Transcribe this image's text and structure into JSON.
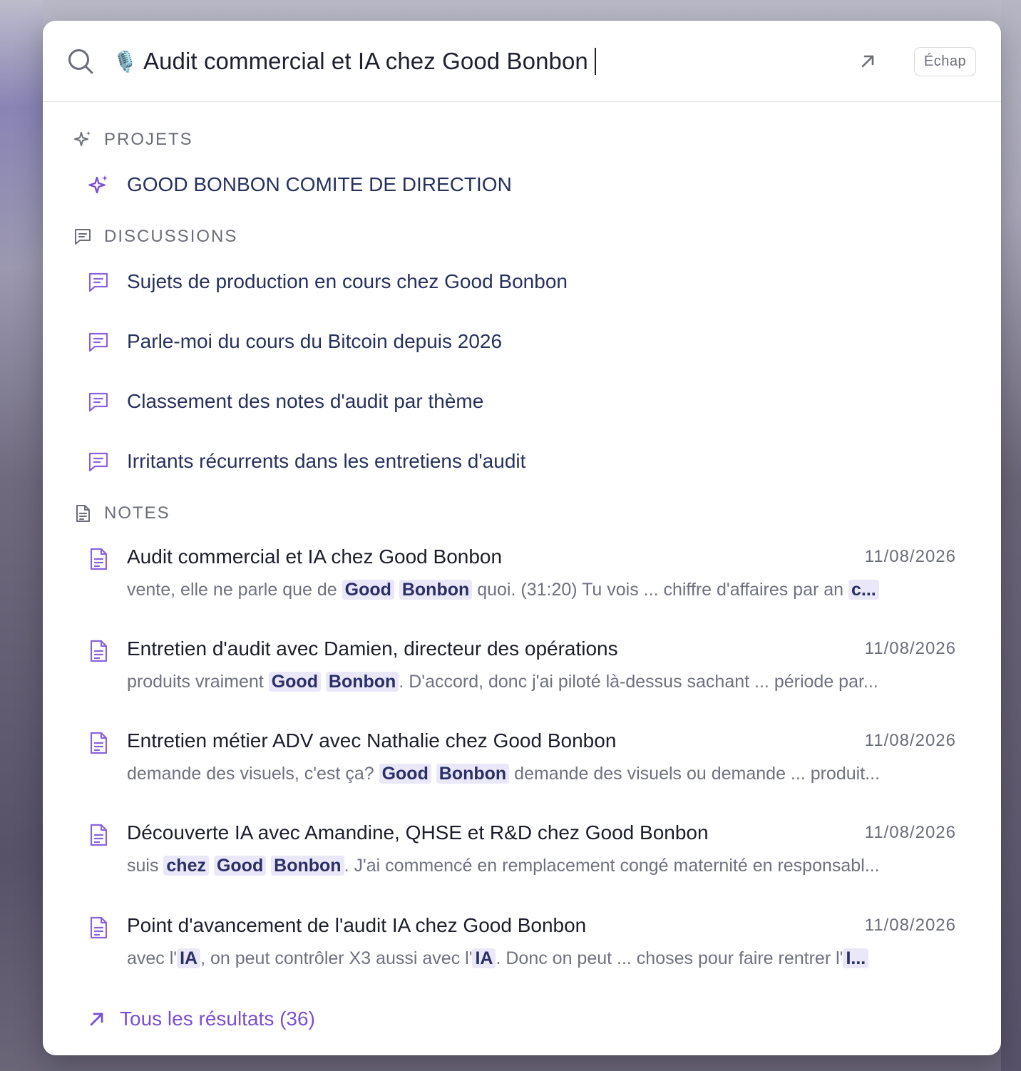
{
  "search": {
    "mic_emoji": "🎙️",
    "query": "Audit commercial et IA chez Good Bonbon",
    "esc_label": "Échap"
  },
  "colors": {
    "accent": "#7a4fd1",
    "highlight_bg": "#e9e7f8",
    "title_text": "#27315e"
  },
  "sections": {
    "projects": {
      "label": "PROJETS",
      "items": [
        {
          "label": "GOOD BONBON COMITE DE DIRECTION"
        }
      ]
    },
    "discussions": {
      "label": "DISCUSSIONS",
      "items": [
        {
          "label": "Sujets de production en cours chez Good Bonbon"
        },
        {
          "label": "Parle-moi du cours du Bitcoin depuis 2026"
        },
        {
          "label": "Classement des notes d'audit par thème"
        },
        {
          "label": "Irritants récurrents dans les entretiens d'audit"
        }
      ]
    },
    "notes": {
      "label": "NOTES",
      "items": [
        {
          "title": "Audit commercial et IA chez Good Bonbon",
          "date": "11/08/2026",
          "snippet": [
            {
              "t": "vente, elle ne parle que de "
            },
            {
              "t": "Good",
              "hl": true
            },
            {
              "t": " "
            },
            {
              "t": "Bonbon",
              "hl": true
            },
            {
              "t": " quoi. (31:20) Tu vois ... chiffre d'affaires par an "
            },
            {
              "t": "c...",
              "hl": true
            }
          ]
        },
        {
          "title": "Entretien d'audit avec Damien, directeur des opérations",
          "date": "11/08/2026",
          "snippet": [
            {
              "t": "produits vraiment "
            },
            {
              "t": "Good",
              "hl": true
            },
            {
              "t": " "
            },
            {
              "t": "Bonbon",
              "hl": true
            },
            {
              "t": ". D'accord, donc j'ai piloté là-dessus sachant ... période par..."
            }
          ]
        },
        {
          "title": "Entretien métier ADV avec Nathalie chez Good Bonbon",
          "date": "11/08/2026",
          "snippet": [
            {
              "t": "demande des visuels, c'est ça? "
            },
            {
              "t": "Good",
              "hl": true
            },
            {
              "t": " "
            },
            {
              "t": "Bonbon",
              "hl": true
            },
            {
              "t": " demande des visuels ou demande ... produit..."
            }
          ]
        },
        {
          "title": "Découverte IA avec Amandine, QHSE et R&D chez Good Bonbon",
          "date": "11/08/2026",
          "snippet": [
            {
              "t": "suis "
            },
            {
              "t": "chez",
              "hl": true
            },
            {
              "t": " "
            },
            {
              "t": "Good",
              "hl": true
            },
            {
              "t": " "
            },
            {
              "t": "Bonbon",
              "hl": true
            },
            {
              "t": ". J'ai commencé en remplacement congé maternité en responsabl..."
            }
          ]
        },
        {
          "title": "Point d'avancement de l'audit IA chez Good Bonbon",
          "date": "11/08/2026",
          "snippet": [
            {
              "t": "avec l'"
            },
            {
              "t": "IA",
              "hl": true
            },
            {
              "t": ", on peut contrôler X3 aussi avec l'"
            },
            {
              "t": "IA",
              "hl": true
            },
            {
              "t": ". Donc on peut ... choses pour faire rentrer l'"
            },
            {
              "t": "I...",
              "hl": true
            }
          ]
        }
      ]
    }
  },
  "footer": {
    "all_results_label": "Tous les résultats (36)"
  }
}
